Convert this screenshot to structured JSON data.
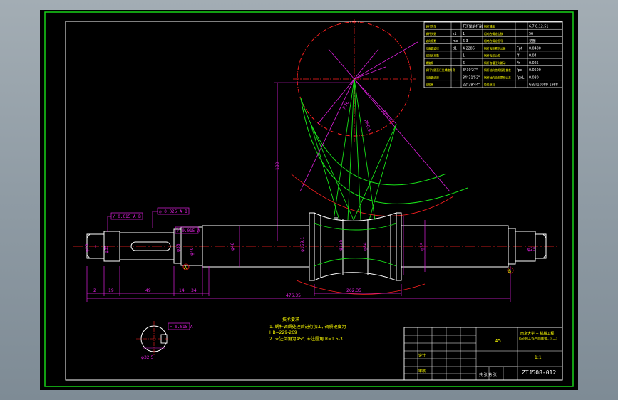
{
  "colors": {
    "background": "#000000",
    "frame": "#19d219",
    "border": "#ffffff",
    "outline": "#ffffff",
    "centerline": "#ff2020",
    "dimension": "#e020e0",
    "green_line": "#19e019",
    "text_yellow": "#ffff00",
    "text_white": "#ffffff"
  },
  "params_table": {
    "rows": [
      {
        "c1": "蜗杆类型",
        "c2": "",
        "c3": "TCF型蜗杆副",
        "c4": "蜗杆精度",
        "c5": "",
        "c6": "6.7.8.12.51"
      },
      {
        "c1": "蜗杆头数",
        "c2": "z1",
        "c3": "1",
        "c4": "相啮合蜗轮齿数",
        "c5": "",
        "c6": "56"
      },
      {
        "c1": "轴向模数",
        "c2": "mx",
        "c3": "6.3",
        "c4": "相啮合蜗轮图号",
        "c5": "",
        "c6": "见图"
      },
      {
        "c1": "分度圆直径",
        "c2": "d1",
        "c3": "4.2286",
        "c4": "蜗杆齿距累积公差",
        "c5": "Fpt",
        "c6": "0.0480"
      },
      {
        "c1": "齿顶高系数",
        "c2": "",
        "c3": "1",
        "c4": "蜗杆齿形公差",
        "c5": "ff",
        "c6": "0.04"
      },
      {
        "c1": "螺旋角",
        "c2": "",
        "c3": "6",
        "c4": "蜗杆齿槽径向跳动",
        "c5": "Fr",
        "c6": "0.025"
      },
      {
        "c1": "蜗杆节圆直径处螺旋升角",
        "c2": "",
        "c3": "3°30'27\"",
        "c4": "蜗杆轴向齿距极限偏差",
        "c5": "fpx",
        "c6": "0.0500"
      },
      {
        "c1": "分度圆齿厚",
        "c2": "",
        "c3": "84°31'52\"",
        "c4": "蜗杆轴向齿距累积公差",
        "c5": "fpxL",
        "c6": "0.030"
      },
      {
        "c1": "齿形角",
        "c2": "",
        "c3": "22°39'44\"",
        "c4": "检验项目",
        "c5": "",
        "c6": "GB/T10089-1988"
      }
    ]
  },
  "dimensions": {
    "total_length": "476.35",
    "worm_length": "262.35",
    "center_height": "180",
    "outer_radius": "R76",
    "pitch_radius": "R60.5",
    "throat_radius": "R87.5",
    "left_seg_1": "2",
    "left_seg_2": "19",
    "left_seg_3": "49",
    "left_seg_4": "14",
    "left_seg_5": "34",
    "left_dia_1": "φ28",
    "left_dia_2": "φ35",
    "left_dia_3": "φ38",
    "left_dia_4": "φ40",
    "mid_dia": "φ48",
    "worm_dia_1": "φ159.1",
    "worm_dia_2": "φ135",
    "worm_dia_3": "φ84",
    "right_dia": "φ35",
    "right_small_dia": "φ25",
    "section_dia": "φ32.5"
  },
  "tolerance_frames": [
    {
      "text": "/ 0.015 A B"
    },
    {
      "text": "◎ 0.025 A B"
    },
    {
      "text": "/ 0.015 A"
    },
    {
      "text": "= 0.015 A"
    }
  ],
  "datums": {
    "a": "A",
    "b": "B"
  },
  "notes": {
    "title": "技术要求",
    "line1": "1. 蜗杆调质处理后进行加工, 调质硬度为",
    "line2": "   HB=229-269",
    "line3": "2. 未注倒角为45°, 未注圆角 R=1.5-3"
  },
  "title_block": {
    "material": "45",
    "company_line1": "南京大学 + 机械工程",
    "company_line2": "(与FM工作台面联接...)(二)",
    "drawing_number": "ZTJ508-012",
    "scale": "1:1",
    "weight": "",
    "designer": "设计",
    "checker": "审核",
    "sheet_line": "共 张  第 张"
  }
}
